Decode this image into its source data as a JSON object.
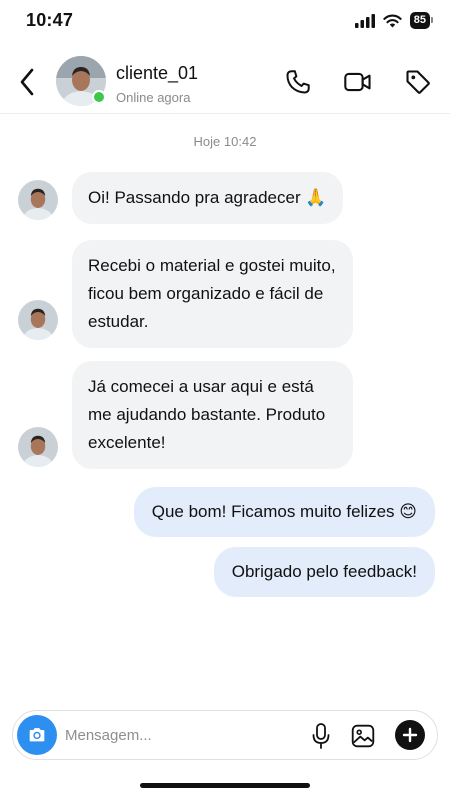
{
  "status_bar": {
    "time": "10:47",
    "battery": "85"
  },
  "header": {
    "contact_name": "cliente_01",
    "contact_status": "Online agora",
    "icons": {
      "back": "chevron-left-icon",
      "call": "phone-icon",
      "video": "video-camera-icon",
      "tag": "tag-icon"
    }
  },
  "chat": {
    "timestamp": "Hoje 10:42",
    "messages": [
      {
        "direction": "incoming",
        "text": "Oi! Passando pra agradecer 🙏"
      },
      {
        "direction": "incoming",
        "text": "Recebi o material e gostei muito, ficou bem organizado e fácil de estudar."
      },
      {
        "direction": "incoming",
        "text": "Já comecei a usar aqui e está me ajudando bastante. Produto excelente!"
      },
      {
        "direction": "outgoing",
        "text": "Que bom! Ficamos muito felizes 😊"
      },
      {
        "direction": "outgoing",
        "text": "Obrigado pelo feedback!"
      }
    ]
  },
  "composer": {
    "placeholder": "Mensagem...",
    "value": "",
    "icons": {
      "camera": "camera-icon",
      "mic": "microphone-icon",
      "gallery": "image-icon",
      "add": "plus-icon"
    }
  },
  "colors": {
    "incoming_bubble": "#f2f3f5",
    "outgoing_bubble": "#e2ecfa",
    "online": "#3ec84b",
    "camera_button": "#2d8ff0"
  }
}
